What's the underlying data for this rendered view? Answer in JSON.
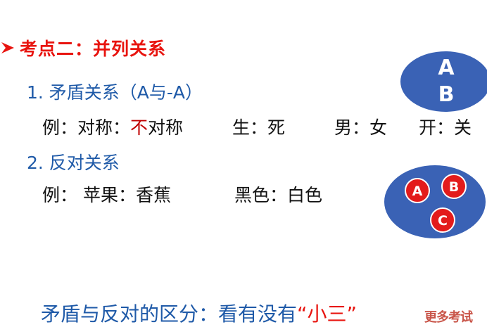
{
  "title": "考点二：并列关系",
  "section1": {
    "heading": "1. 矛盾关系（A与-A）",
    "example_prefix": "例：对称：",
    "example_red": "不",
    "example_suffix": "对称",
    "pair2": "生：死",
    "pair3": "男：女",
    "pair4": "开：关"
  },
  "section2": {
    "heading": "2. 反对关系",
    "example1": "例：  苹果：香蕉",
    "example2": "黑色：白色"
  },
  "diagram1": {
    "label_a": "A",
    "label_b": "B"
  },
  "diagram2": {
    "label_a": "A",
    "label_b": "B",
    "label_c": "C"
  },
  "footer": {
    "text": "矛盾与反对的区分：看有没有",
    "highlight": "“小三”"
  },
  "watermark": "更多考试",
  "colors": {
    "accent_red": "#e8140f",
    "text_blue": "#1f5aa8",
    "ellipse_blue": "#3a62b5",
    "dot_red": "#e31b1b"
  }
}
